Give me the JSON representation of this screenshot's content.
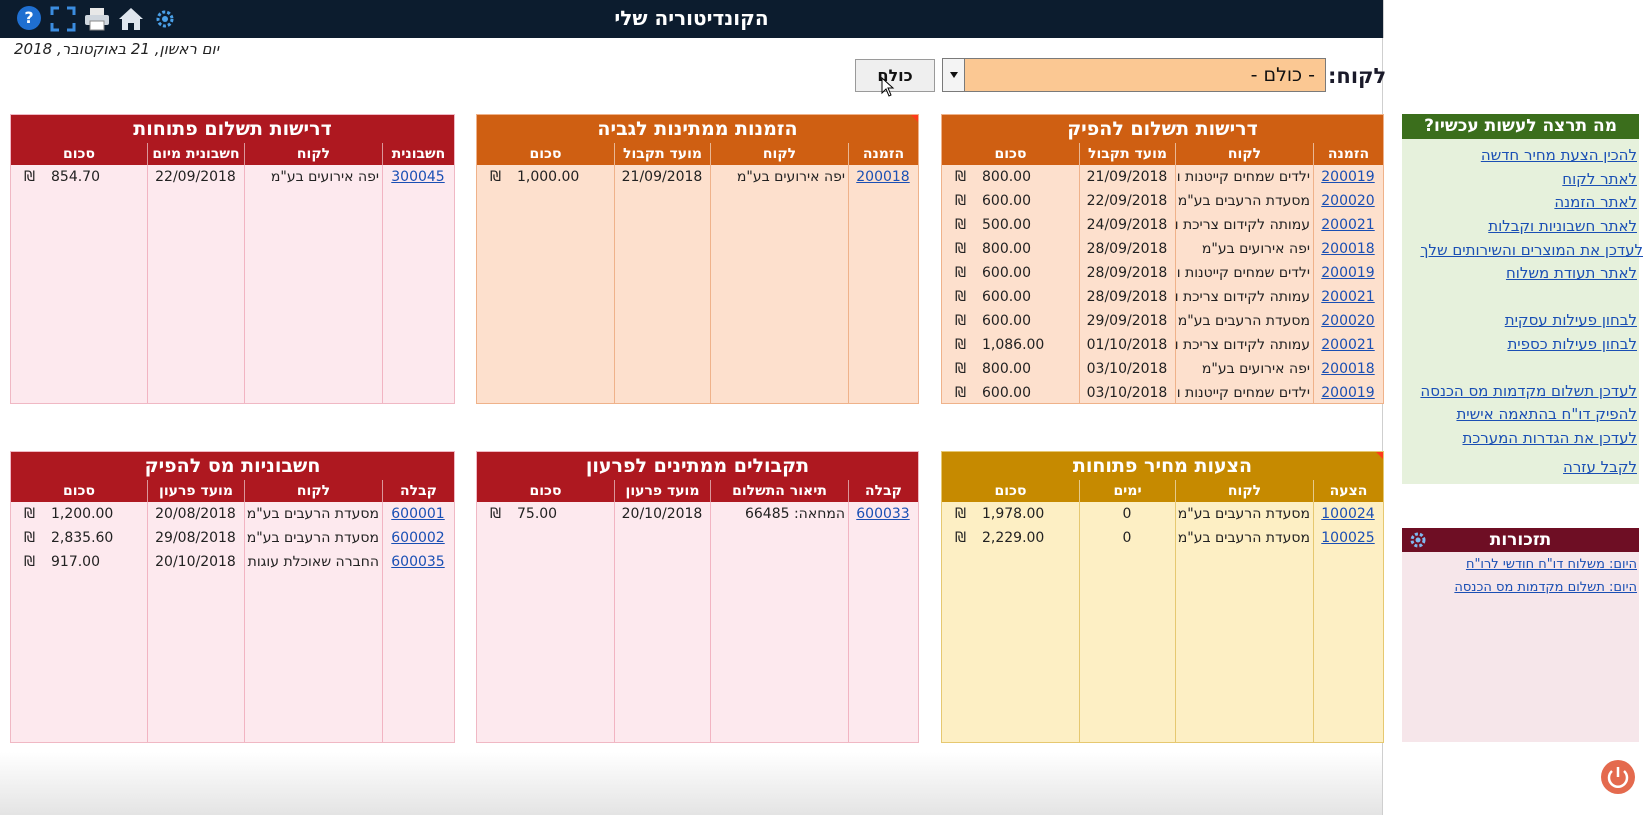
{
  "app_title": "הקונדיטוריה שלי",
  "toolbar": {
    "icons": [
      "help-icon",
      "fullscreen-icon",
      "print-icon",
      "home-icon",
      "settings-icon"
    ],
    "help_glyph": "?"
  },
  "date_text": "יום ראשון, 21 באוקטובר, 2018",
  "filter": {
    "customer_label": "לקוח:",
    "customer_value": "- כולם -",
    "all_button": "כולם"
  },
  "currency": "₪",
  "panels": {
    "payment_requests": {
      "title": "דרישות תשלום להפיק",
      "headers": [
        "הזמנה",
        "לקוח",
        "מועד תקבול",
        "סכום"
      ],
      "rows": [
        [
          "200019",
          "ילדים שמחים קייטנות ו",
          "21/09/2018",
          "800.00"
        ],
        [
          "200020",
          "מסעדת הרעבים בע\"מ",
          "22/09/2018",
          "600.00"
        ],
        [
          "200021",
          "עמותה לקידום צריכת ו",
          "24/09/2018",
          "500.00"
        ],
        [
          "200018",
          "יפה אירועים בע\"מ",
          "28/09/2018",
          "800.00"
        ],
        [
          "200019",
          "ילדים שמחים קייטנות ו",
          "28/09/2018",
          "600.00"
        ],
        [
          "200021",
          "עמותה לקידום צריכת ו",
          "28/09/2018",
          "600.00"
        ],
        [
          "200020",
          "מסעדת הרעבים בע\"מ",
          "29/09/2018",
          "600.00"
        ],
        [
          "200021",
          "עמותה לקידום צריכת ו",
          "01/10/2018",
          "1,086.00"
        ],
        [
          "200018",
          "יפה אירועים בע\"מ",
          "03/10/2018",
          "800.00"
        ],
        [
          "200019",
          "ילדים שמחים קייטנות ו",
          "03/10/2018",
          "600.00"
        ]
      ]
    },
    "pending_orders": {
      "title": "הזמנות ממתינות לגביה",
      "headers": [
        "הזמנה",
        "לקוח",
        "מועד תקבול",
        "סכום"
      ],
      "rows": [
        [
          "200018",
          "יפה אירועים בע\"מ",
          "21/09/2018",
          "1,000.00"
        ]
      ]
    },
    "open_payment_requests": {
      "title": "דרישות תשלום פתוחות",
      "headers": [
        "חשבונית",
        "לקוח",
        "חשבונית מיום",
        "סכום"
      ],
      "rows": [
        [
          "300045",
          "יפה אירועים בע\"מ",
          "22/09/2018",
          "854.70"
        ]
      ]
    },
    "open_quotes": {
      "title": "הצעות מחיר פתוחות",
      "headers": [
        "הצעה",
        "לקוח",
        "ימים",
        "סכום"
      ],
      "rows": [
        [
          "100024",
          "מסעדת הרעבים בע\"מ",
          "0",
          "1,978.00"
        ],
        [
          "100025",
          "מסעדת הרעבים בע\"מ",
          "0",
          "2,229.00"
        ]
      ]
    },
    "pending_receipts": {
      "title": "תקבולים ממתינים לפרעון",
      "headers": [
        "קבלה",
        "תיאור התשלום",
        "מועד פרעון",
        "סכום"
      ],
      "rows": [
        [
          "600033",
          "המחאה: 66485",
          "20/10/2018",
          "75.00"
        ]
      ]
    },
    "tax_invoices": {
      "title": "חשבוניות מס להפיק",
      "headers": [
        "קבלה",
        "לקוח",
        "מועד פרעון",
        "סכום"
      ],
      "rows": [
        [
          "600001",
          "מסעדת הרעבים בע\"מ",
          "20/08/2018",
          "1,200.00"
        ],
        [
          "600002",
          "מסעדת הרעבים בע\"מ",
          "29/08/2018",
          "2,835.60"
        ],
        [
          "600035",
          "החברה שאוכלת עוגות",
          "20/10/2018",
          "917.00"
        ]
      ]
    }
  },
  "actions": {
    "title": "מה תרצה לעשות עכשיו?",
    "links": [
      "להכין הצעת מחיר חדשה",
      "לאתר לקוח",
      "לאתר הזמנה",
      "לאתר חשבוניות וקבלות",
      "לעדכן את המוצרים והשירותים שלך",
      "לאתר תעודת משלוח",
      "לבחון פעילות עסקית",
      "לבחון פעילות כספית",
      "לעדכן תשלום מקדמות מס הכנסה",
      "להפיק דו\"ח בהתאמה אישית",
      "לעדכן את הגדרות המערכת",
      "לקבל עזרה"
    ]
  },
  "reminders": {
    "title": "תזכורות",
    "items": [
      "היום: משלוח דו\"ח חודשי לרו\"ח",
      "היום: תשלום מקדמות מס הכנסה"
    ]
  }
}
